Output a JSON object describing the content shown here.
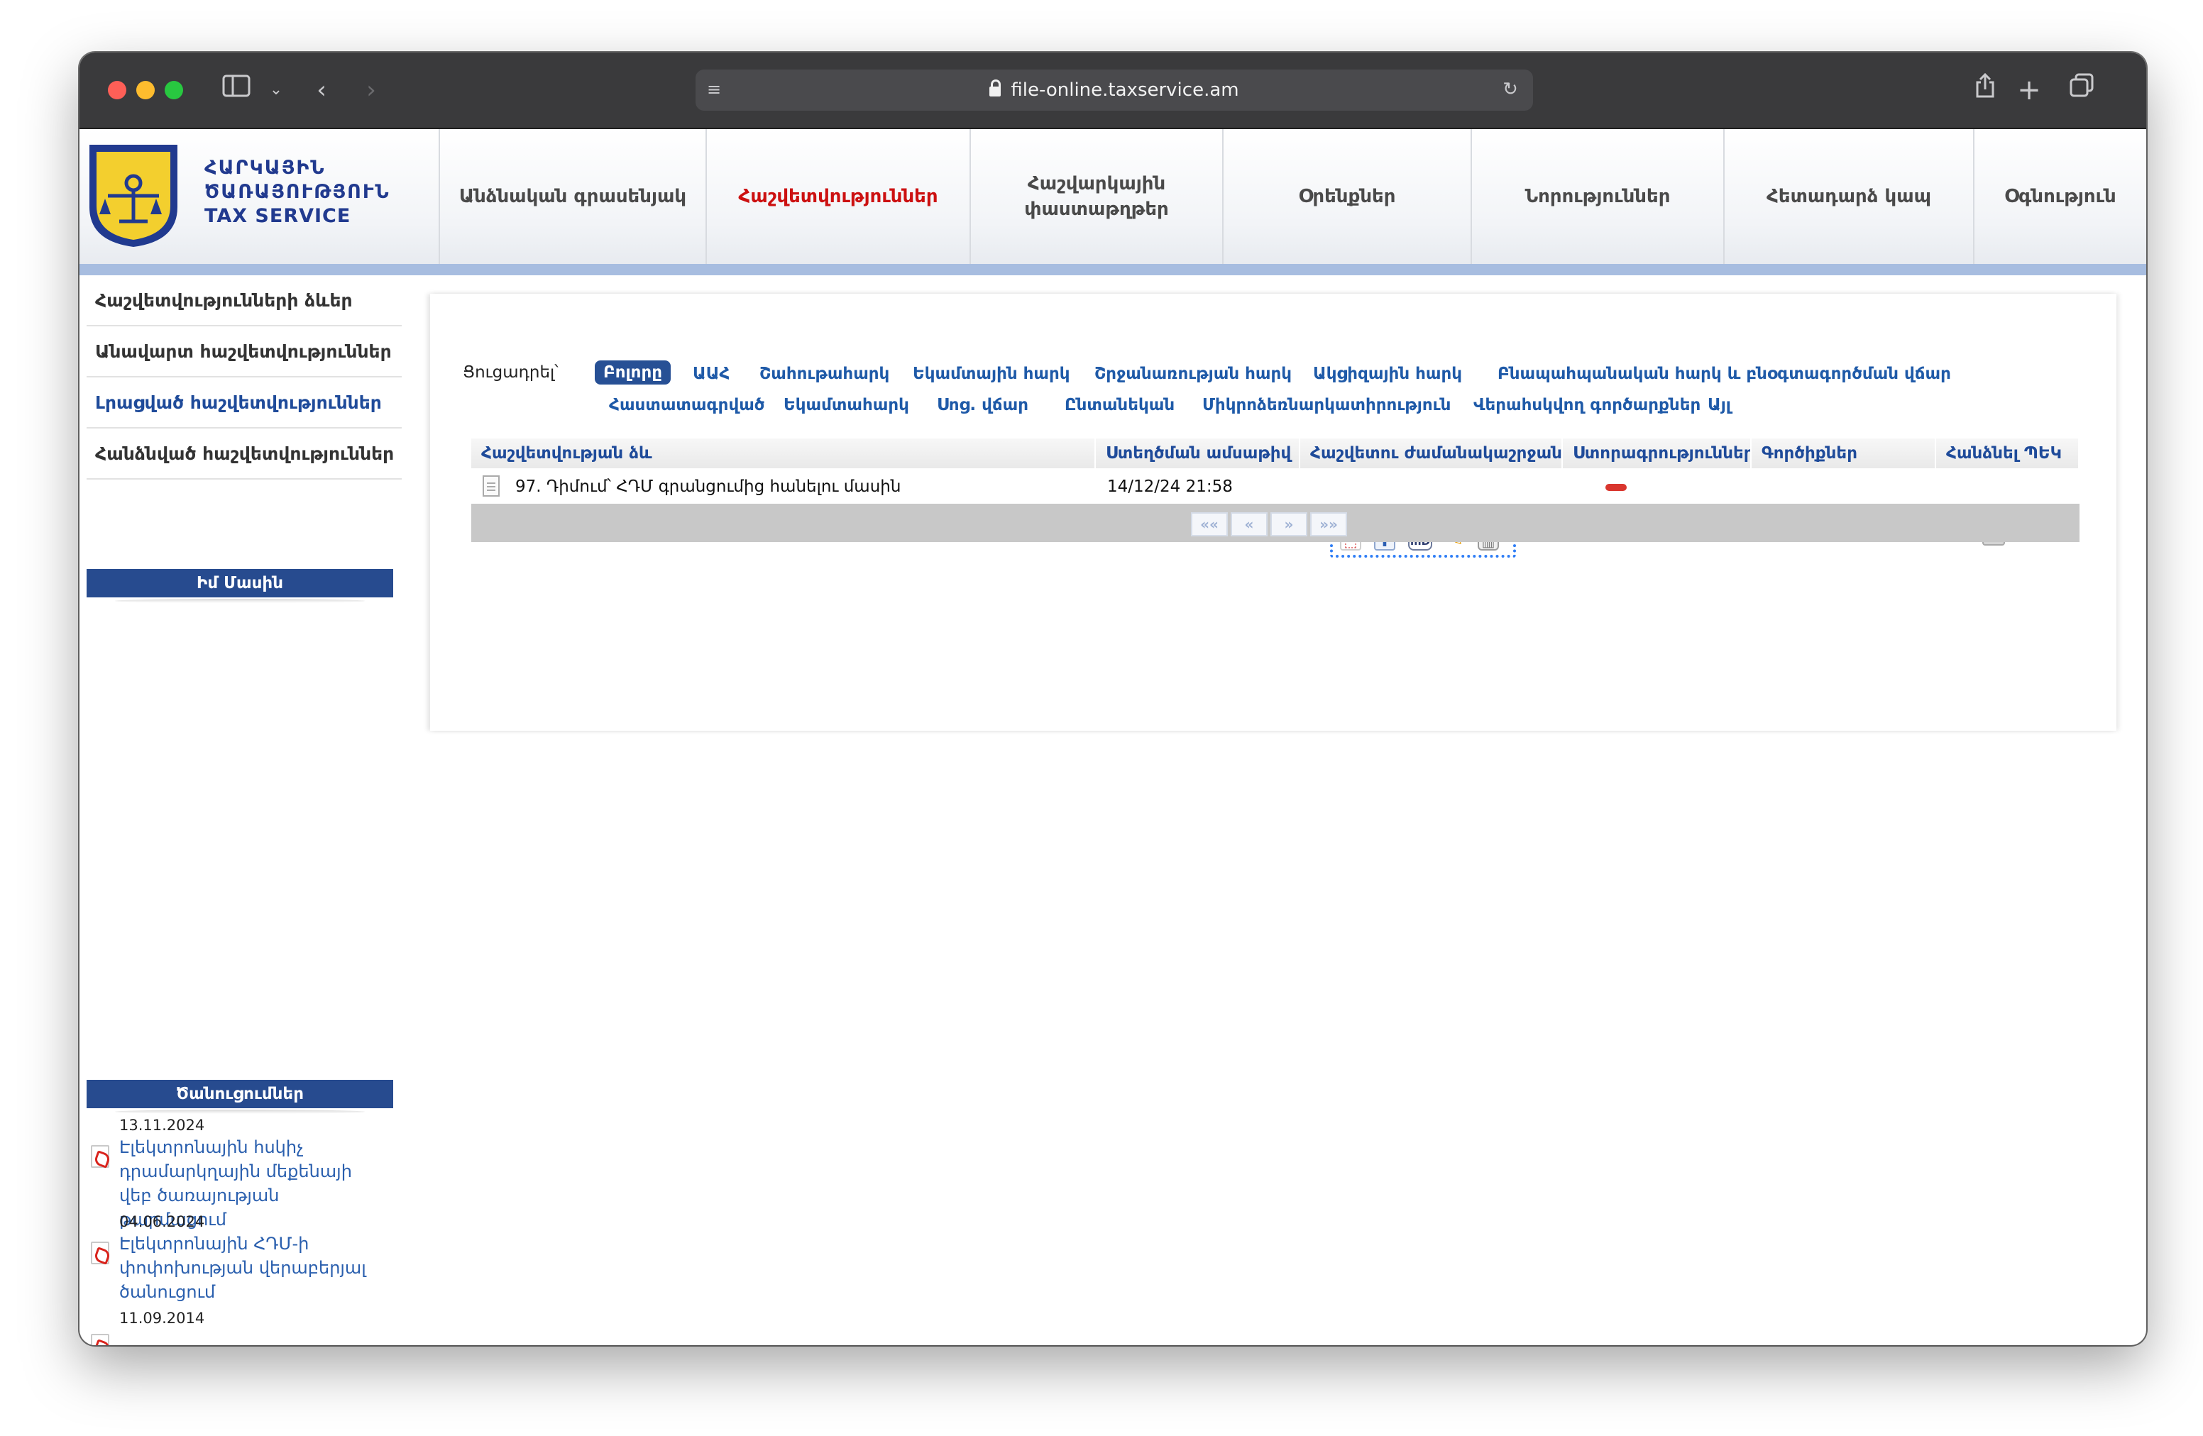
{
  "browser": {
    "url": "file-online.taxservice.am"
  },
  "logo": {
    "line1": "ՀԱՐԿԱՅԻՆ",
    "line2": "ԾԱՌԱՅՈՒԹՅՈՒՆ",
    "line3": "TAX SERVICE"
  },
  "nav": [
    {
      "label": "Անձնական գրասենյակ"
    },
    {
      "label": "Հաշվետվություններ"
    },
    {
      "label": "Հաշվարկային փաստաթղթեր"
    },
    {
      "label": "Օրենքներ"
    },
    {
      "label": "Նորություններ"
    },
    {
      "label": "Հետադարձ կապ"
    },
    {
      "label": "Օգնություն"
    }
  ],
  "sidebar": {
    "items": [
      {
        "label": "Հաշվետվությունների ձևեր"
      },
      {
        "label": "Անավարտ հաշվետվություններ"
      },
      {
        "label": "Լրացված հաշվետվություններ"
      },
      {
        "label": "Հանձնված հաշվետվություններ"
      }
    ],
    "about_heading": "Իմ Մասին",
    "announcements_heading": "Ծանուցումներ",
    "announcements": [
      {
        "date": "13.11.2024",
        "title": "Էլեկտրոնային հսկիչ դրամարկղային մեքենայի վեբ ծառայության թարմացում"
      },
      {
        "date": "04.06.2024",
        "title": "Էլեկտրոնային ՀԴՄ-ի փոփոխության վերաբերյալ ծանուցում"
      },
      {
        "date": "11.09.2014",
        "title": ""
      }
    ]
  },
  "filters": {
    "label": "Ցուցադրել՝",
    "row1": [
      "Բոլորը",
      "ԱԱՀ",
      "Շահութահարկ",
      "Եկամտային հարկ",
      "Շրջանառության հարկ",
      "Ակցիզային հարկ",
      "Բնապահպանական հարկ և բնօգտագործման վճար"
    ],
    "row2": [
      "Հաստատագրված",
      "Եկամտահարկ",
      "Սոց. վճար",
      "Ընտանեկան",
      "Միկրոձեռնարկատիրություն",
      "Վերահսկվող գործարքներ",
      "Այլ"
    ],
    "selected": "Բոլորը"
  },
  "table": {
    "columns": [
      "Հաշվետվության ձև",
      "Ստեղծման ամսաթիվ",
      "Հաշվետու ժամանակաշրջան",
      "Ստորագրություններ",
      "Գործիքներ",
      "Հանձնել ՊԵԿ"
    ],
    "rows": [
      {
        "form": "97. Դիմում՝ ՀԴՄ գրանցումից հանելու մասին",
        "created": "14/12/24 21:58",
        "period": ""
      }
    ],
    "pager": [
      "««",
      "«",
      "»",
      "»»"
    ]
  },
  "colors": {
    "accent": "#275095",
    "active_nav": "#cc1111",
    "link": "#1f5aa8",
    "header_stripe": "#a7bde0",
    "selection_outline": "#2f7ef6"
  },
  "icons": {
    "row_tools": [
      "pdf-icon",
      "upload-icon",
      "md-icon",
      "edit-icon",
      "trash-icon"
    ],
    "submit": "send-to-tax-icon"
  }
}
